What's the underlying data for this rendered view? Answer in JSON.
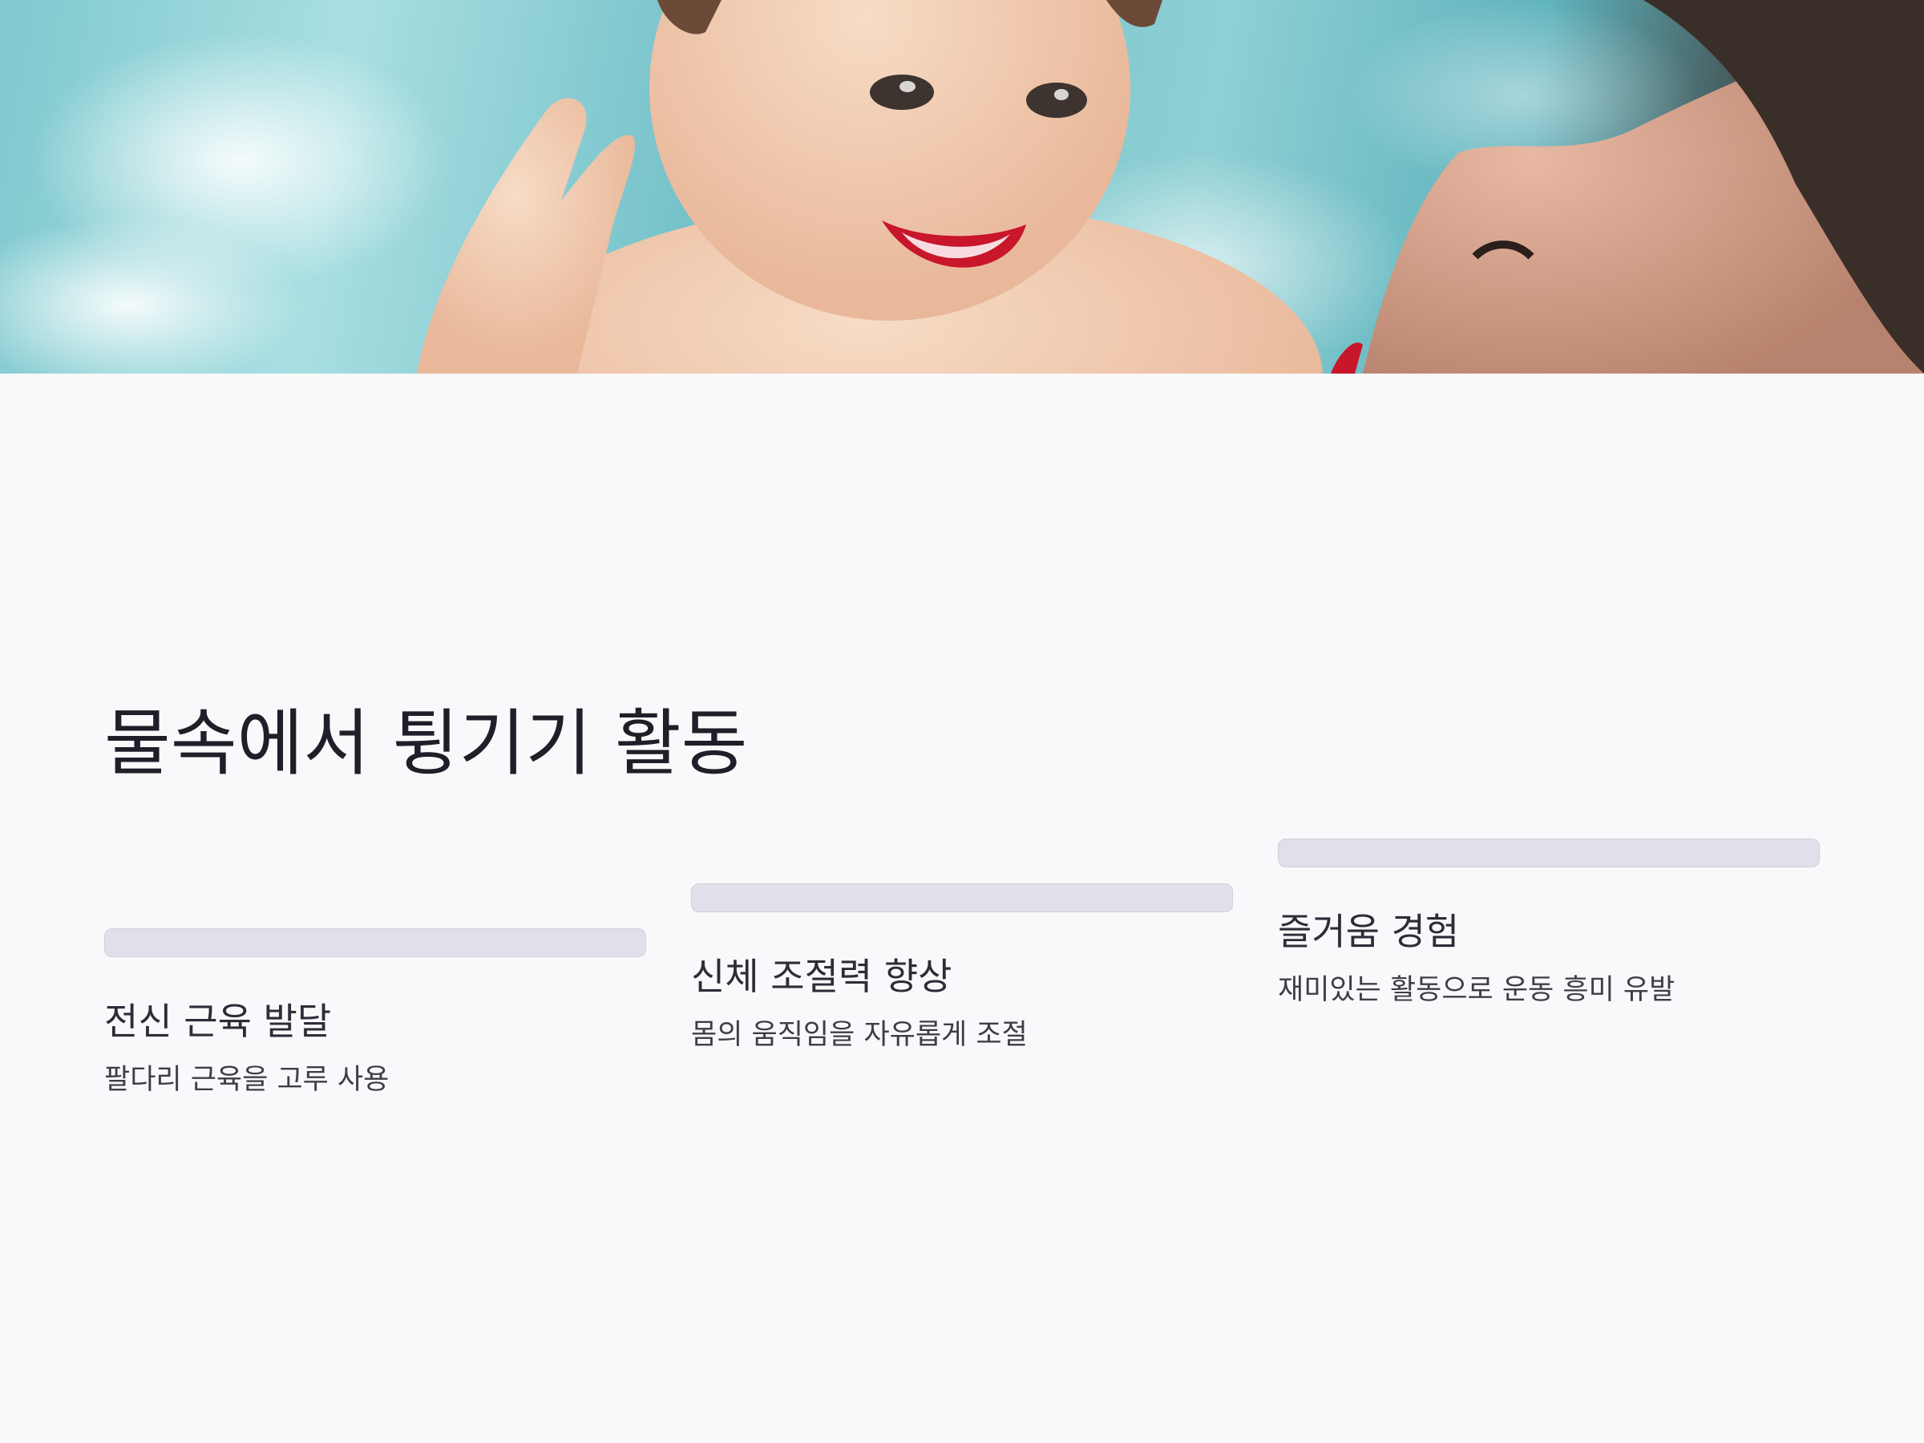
{
  "header_image": {
    "alt": "물속에서 웃고 있는 아기와 엄마",
    "colors": {
      "water": "#7fc9cf",
      "skin": "#f2cdb3",
      "hair": "#3a2e28"
    }
  },
  "page": {
    "title": "물속에서 튕기기 활동"
  },
  "cards": [
    {
      "title": "전신 근육 발달",
      "description": "팔다리 근육을 고루 사용"
    },
    {
      "title": "신체 조절력 향상",
      "description": "몸의 움직임을 자유롭게 조절"
    },
    {
      "title": "즐거움 경험",
      "description": "재미있는 활동으로 운동 흥미 유발"
    }
  ],
  "colors": {
    "background": "#f9f9fb",
    "bar": "#e0e0ea",
    "title_text": "#1e1f29"
  }
}
